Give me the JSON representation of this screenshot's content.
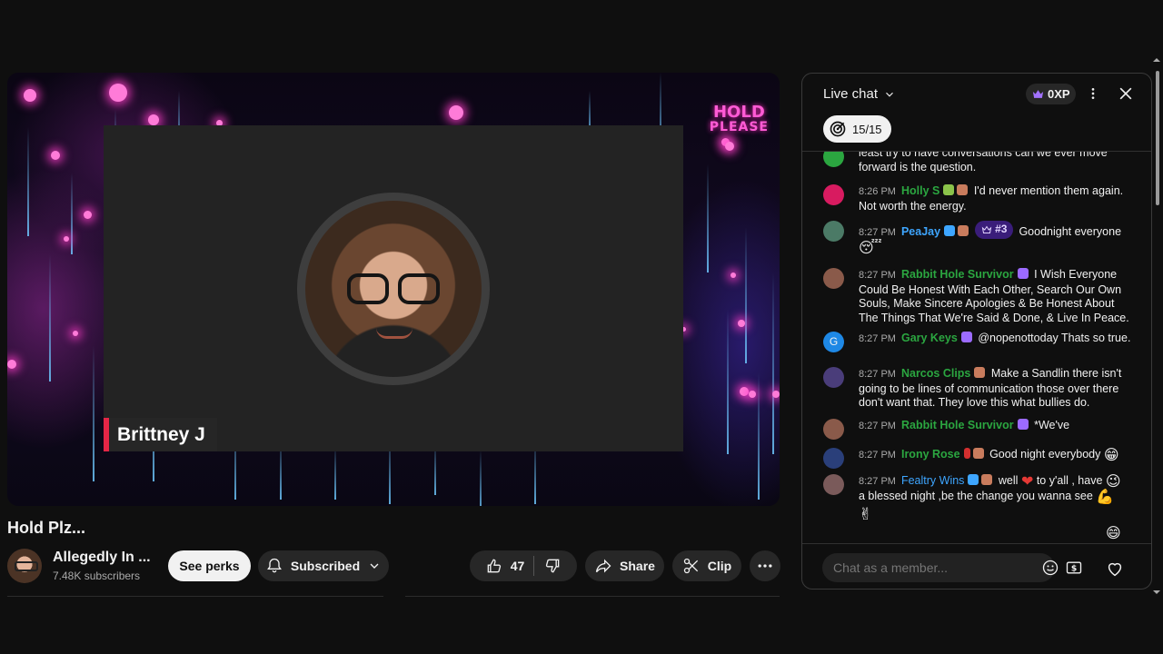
{
  "video": {
    "participant_name": "Brittney J",
    "overlay_line1": "HOLD",
    "overlay_line2": "PLEASE"
  },
  "title": "Hold Plz...",
  "channel": {
    "name": "Allegedly In ...",
    "subscribers": "7.48K subscribers"
  },
  "actions": {
    "perks": "See perks",
    "subscribed": "Subscribed",
    "likes": "47",
    "share": "Share",
    "clip": "Clip"
  },
  "chat": {
    "title": "Live chat",
    "xp": "0XP",
    "goal": "15/15",
    "input_placeholder": "Chat as a member...",
    "messages": [
      {
        "time": "",
        "author": "",
        "text": "least try to have conversations can we ever move forward is the question.",
        "avatar_color": "#2ba640"
      },
      {
        "time": "8:26 PM",
        "author": "Holly S",
        "text": "I'd never mention them again. Not worth the energy.",
        "avatar_color": "#d81b60"
      },
      {
        "time": "8:27 PM",
        "author": "PeaJay",
        "rank": "#3",
        "text": "Goodnight everyone",
        "avatar_color": "#4b7a66"
      },
      {
        "time": "8:27 PM",
        "author": "Rabbit Hole Survivor",
        "text": "I Wish Everyone Could Be Honest With Each Other, Search Our Own Souls, Make Sincere Apologies & Be Honest About The Things That We're Said & Done, & Live In Peace.",
        "avatar_color": "#8a5a4a"
      },
      {
        "time": "8:27 PM",
        "author": "Gary Keys",
        "text": "@nopenottoday Thats so true.",
        "avatar_color": "#1e88e5",
        "avatar_letter": "G"
      },
      {
        "time": "8:27 PM",
        "author": "Narcos Clips",
        "text": "Make a Sandlin there isn't going to be lines of communication those over there don't want that. They love this what bullies do.",
        "avatar_color": "#4a3d7a"
      },
      {
        "time": "8:27 PM",
        "author": "Rabbit Hole Survivor",
        "text": "*We've",
        "avatar_color": "#8a5a4a"
      },
      {
        "time": "8:27 PM",
        "author": "Irony Rose",
        "text": "Good night everybody",
        "avatar_color": "#2a3f7a"
      },
      {
        "time": "8:27 PM",
        "author": "Fealtry Wins",
        "text": "well",
        "text2": "to y'all , have",
        "text3": "a blessed night ,be the change you wanna see",
        "avatar_color": "#7a5a5a"
      }
    ]
  },
  "colors": {
    "background": "#0f0f0f",
    "author_green": "#2ba640",
    "author_blue": "#3ea6ff",
    "name_tag_accent": "#e52646",
    "overlay_pink": "#ff5bd5"
  }
}
